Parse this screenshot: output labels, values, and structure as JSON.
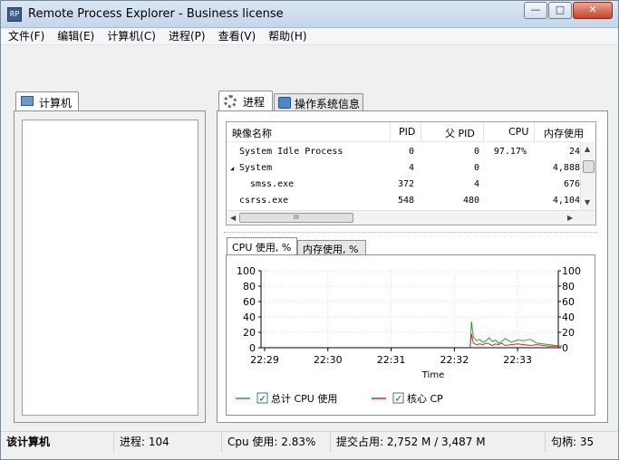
{
  "window": {
    "title": "Remote Process Explorer - Business license",
    "app_icon_text": "RP"
  },
  "menu": {
    "items": [
      "文件(F)",
      "编辑(E)",
      "计算机(C)",
      "进程(P)",
      "查看(V)",
      "帮助(H)"
    ]
  },
  "left_panel": {
    "tab_label": "计算机"
  },
  "right_tabs": {
    "processes": "进程",
    "os_info": "操作系统信息"
  },
  "process_table": {
    "columns": [
      "映像名称",
      "PID",
      "父 PID",
      "CPU",
      "内存使用"
    ],
    "rows": [
      {
        "name": "System Idle Process",
        "pid": "0",
        "ppid": "0",
        "cpu": "97.17%",
        "mem": "24"
      },
      {
        "name": "System",
        "pid": "4",
        "ppid": "0",
        "cpu": "",
        "mem": "4,888"
      },
      {
        "name": "smss.exe",
        "pid": "372",
        "ppid": "4",
        "cpu": "",
        "mem": "676"
      },
      {
        "name": "csrss.exe",
        "pid": "548",
        "ppid": "480",
        "cpu": "",
        "mem": "4,104"
      }
    ],
    "expand_glyph": "◢",
    "scroll_thumb_glyph": "III"
  },
  "chart_tabs": {
    "cpu": "CPU 使用, %",
    "mem": "内存使用, %"
  },
  "chart_data": {
    "type": "line",
    "xlabel": "Time",
    "ylim": [
      0,
      100
    ],
    "y_ticks": [
      0,
      20,
      40,
      60,
      80,
      100
    ],
    "x_ticks": [
      "22:29",
      "22:30",
      "22:31",
      "22:32",
      "22:33"
    ],
    "grid": true,
    "series": [
      {
        "name": "总计 CPU 使用",
        "color": "#2ca02c",
        "x": [
          32.25,
          32.27,
          32.3,
          32.35,
          32.4,
          32.45,
          32.5,
          32.55,
          32.6,
          32.65,
          32.7,
          32.75,
          32.8,
          32.9,
          33.0,
          33.1,
          33.2,
          33.3,
          33.4,
          33.5,
          33.6,
          33.7
        ],
        "y": [
          0,
          34,
          14,
          9,
          11,
          7,
          9,
          13,
          8,
          10,
          6,
          8,
          12,
          7,
          10,
          9,
          11,
          6,
          5,
          4,
          3,
          2
        ]
      },
      {
        "name": "核心 CP",
        "color": "#d62728",
        "x": [
          32.25,
          32.27,
          32.3,
          32.35,
          32.4,
          32.45,
          32.5,
          32.55,
          32.6,
          32.65,
          32.7,
          32.75,
          32.8,
          32.9,
          33.0,
          33.1,
          33.2,
          33.3,
          33.4,
          33.5,
          33.6,
          33.7
        ],
        "y": [
          0,
          18,
          6,
          4,
          5,
          4,
          6,
          5,
          3,
          5,
          4,
          6,
          3,
          4,
          5,
          4,
          3,
          4,
          3,
          2,
          2,
          2
        ]
      }
    ]
  },
  "status_bar": {
    "computer": "该计算机",
    "processes": "进程: 104",
    "cpu": "Cpu 使用: 2.83%",
    "commit": "提交占用: 2,752 M / 3,487 M",
    "handles": "句柄: 35"
  },
  "colors": {
    "titlebar": "#c4d6ea",
    "close": "#c6442b",
    "cpu_series": "#2ca02c",
    "core_series": "#d62728"
  }
}
